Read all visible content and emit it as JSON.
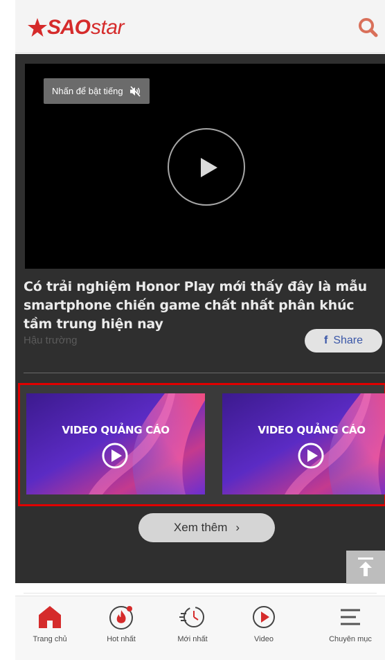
{
  "header": {
    "logo_bold": "SAO",
    "logo_light": "star",
    "search_icon": "search-icon"
  },
  "video": {
    "mute_tooltip": "Nhấn để bật tiếng",
    "mute_icon": "speaker-muted-icon",
    "play_icon": "play-icon"
  },
  "article": {
    "title": "Có trải nghiệm Honor Play mới thấy đây là mẫu smartphone chiến game chất nhất phân khúc tầm trung hiện nay",
    "category": "Hậu trường",
    "share_label": "Share",
    "share_icon_glyph": "f"
  },
  "ads": [
    {
      "label": "VIDEO QUẢNG CÁO"
    },
    {
      "label": "VIDEO QUẢNG CÁO"
    }
  ],
  "more": {
    "label": "Xem thêm",
    "chevron": "›"
  },
  "bottom_nav": [
    {
      "label": "Trang chủ",
      "icon": "home-icon"
    },
    {
      "label": "Hot nhất",
      "icon": "flame-icon"
    },
    {
      "label": "Mới nhất",
      "icon": "clock-icon"
    },
    {
      "label": "Video",
      "icon": "video-play-icon"
    },
    {
      "label": "Chuyên mục",
      "icon": "menu-icon"
    }
  ],
  "colors": {
    "brand_red": "#d52b2b",
    "ad_outline": "#e00000",
    "dim_overlay": "#2f2f2f"
  }
}
